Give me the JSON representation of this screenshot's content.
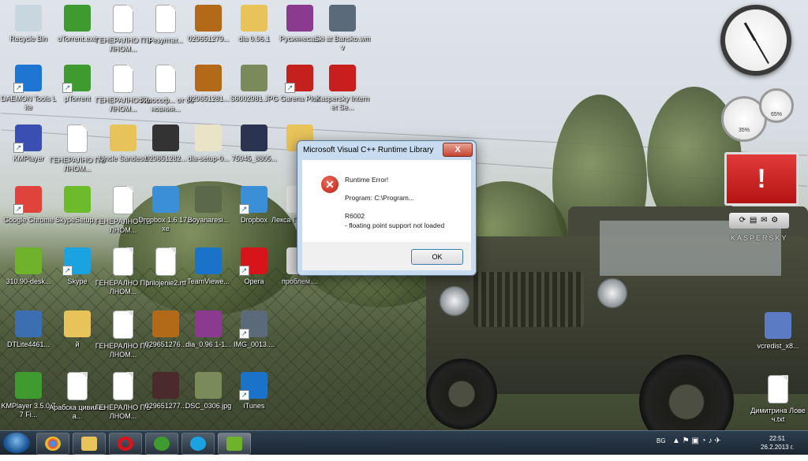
{
  "desktop_icons": [
    {
      "label": "Recycle Bin"
    },
    {
      "label": "uTorrent.exe"
    },
    {
      "label": "ГЕНЕРАЛНО ПЪЛНОМ..."
    },
    {
      "label": "Резултат..."
    },
    {
      "label": "029651279..."
    },
    {
      "label": "dia 0.96.1"
    },
    {
      "label": "Русиянеса..."
    },
    {
      "label": "Ski at Bansko.wmv"
    },
    {
      "label": "DAEMON Tools Lite"
    },
    {
      "label": "µTorrent"
    },
    {
      "label": "ГЕНЕРАЛНО ПЪЛНОМ..."
    },
    {
      "label": "Философ... от основния..."
    },
    {
      "label": "029651281..."
    },
    {
      "label": "S6002981.JPG"
    },
    {
      "label": "Garena Plus"
    },
    {
      "label": "Kaspersky Internet Se..."
    },
    {
      "label": "KMPlayer"
    },
    {
      "label": "ГЕНЕРАЛНО ПЪЛНОМ..."
    },
    {
      "label": "Uncle Sandeso"
    },
    {
      "label": "029651282..."
    },
    {
      "label": "dia-setup-0..."
    },
    {
      "label": "75945_8805..."
    },
    {
      "label": "й"
    },
    {
      "label": "Google Chrome"
    },
    {
      "label": "SkypeSetup..."
    },
    {
      "label": "ГЕНЕРАЛНО ПЪЛНОМ..."
    },
    {
      "label": "Dropbox 1.6.17.exe"
    },
    {
      "label": "Boyanaresi..."
    },
    {
      "label": "Dropbox"
    },
    {
      "label": "Лекса Плевенско"
    },
    {
      "label": "310.90-desk..."
    },
    {
      "label": "Skype"
    },
    {
      "label": "ГЕНЕРАЛНО ПЪЛНОМ..."
    },
    {
      "label": "prilojenie2.rtf"
    },
    {
      "label": "TeamViewe..."
    },
    {
      "label": "Opera"
    },
    {
      "label": "проблем...."
    },
    {
      "label": "DTLite4461..."
    },
    {
      "label": "й"
    },
    {
      "label": "ГЕНЕРАЛНО ПЪЛНОМ..."
    },
    {
      "label": "029651276..."
    },
    {
      "label": "dia_0.96.1-1..."
    },
    {
      "label": "IMG_0013...."
    },
    {
      "label": "KMPlayer 3.5.0.77 Fi..."
    },
    {
      "label": "Арабска цивилиза..."
    },
    {
      "label": "ГЕНЕРАЛНО ПЪЛНОМ..."
    },
    {
      "label": "029651277..."
    },
    {
      "label": "DSC_0306.jpg"
    },
    {
      "label": "iTunes"
    },
    {
      "label": "vcredist_x8..."
    },
    {
      "label": "Димитрина Ловеч.txt"
    }
  ],
  "dialog": {
    "title": "Microsoft Visual C++ Runtime Library",
    "close_label": "X",
    "heading": "Runtime Error!",
    "program_line": "Program: C:\\Program...",
    "code_line": "R6002",
    "detail_line": "- floating point support not loaded",
    "ok_label": "OK"
  },
  "gadgets": {
    "cpu_percent": "35%",
    "mem_percent": "65%",
    "kaspersky_label": "KASPERSKY",
    "kaspersky_mark": "!"
  },
  "taskbar": {
    "language": "BG",
    "time": "22:51",
    "date": "26.2.2013 г."
  }
}
